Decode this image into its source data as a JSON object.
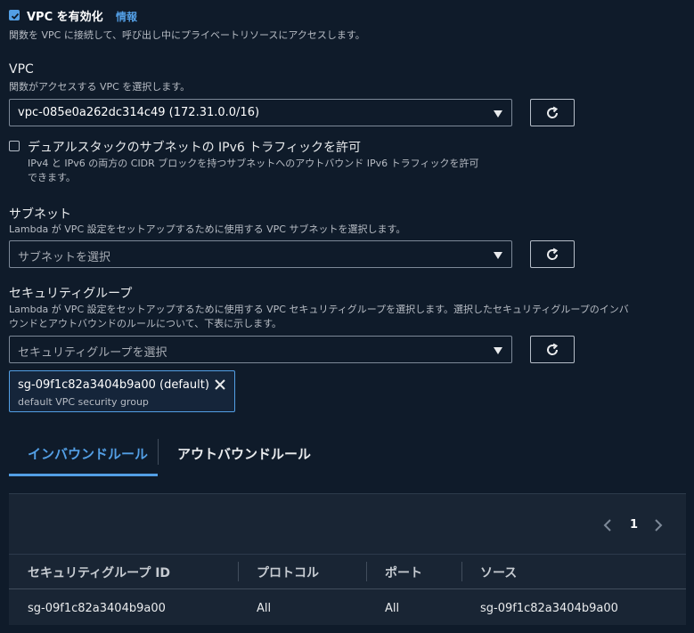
{
  "vpc_toggle": {
    "checked": true,
    "label": "VPC を有効化",
    "info_link": "情報",
    "description": "関数を VPC に接続して、呼び出し中にプライベートリソースにアクセスします。"
  },
  "vpc": {
    "label": "VPC",
    "description": "関数がアクセスする VPC を選択します。",
    "selected": "vpc-085e0a262dc314c49 (172.31.0.0/16)"
  },
  "dual_stack": {
    "checked": false,
    "label": "デュアルスタックのサブネットの IPv6 トラフィックを許可",
    "description_line1": "IPv4 と IPv6 の両方の CIDR ブロックを持つサブネットへのアウトバウンド IPv6 トラフィックを許可",
    "description_line2": "できます。"
  },
  "subnets": {
    "label": "サブネット",
    "description": "Lambda が VPC 設定をセットアップするために使用する VPC サブネットを選択します。",
    "placeholder": "サブネットを選択"
  },
  "security_groups": {
    "label": "セキュリティグループ",
    "description_line1": "Lambda が VPC 設定をセットアップするために使用する VPC セキュリティグループを選択します。選択したセキュリティグループのインバ",
    "description_line2": "ウンドとアウトバウンドのルールについて、下表に示します。",
    "placeholder": "セキュリティグループを選択",
    "token": {
      "title": "sg-09f1c82a3404b9a00 (default)",
      "subtitle": "default VPC security group"
    }
  },
  "tabs": [
    {
      "label": "インバウンドルール",
      "active": true
    },
    {
      "label": "アウトバウンドルール",
      "active": false
    }
  ],
  "pagination": {
    "current_page": "1"
  },
  "table": {
    "headers": [
      "セキュリティグループ ID",
      "プロトコル",
      "ポート",
      "ソース"
    ],
    "rows": [
      [
        "sg-09f1c82a3404b9a00",
        "All",
        "All",
        "sg-09f1c82a3404b9a00"
      ]
    ]
  },
  "colors": {
    "background": "#0f1b2a",
    "accent": "#539fe5",
    "panel": "#192534"
  },
  "icons": [
    "checkbox-checked-icon",
    "refresh-icon",
    "caret-down-icon",
    "close-icon",
    "chevron-left-icon",
    "chevron-right-icon"
  ]
}
